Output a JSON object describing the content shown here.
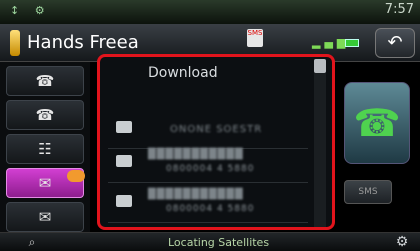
{
  "status_bar": {
    "time": "7:57",
    "icons": "↕ ⚙"
  },
  "header": {
    "title": "Hands Freea",
    "sms_label": "SMS",
    "back_symbol": "↶"
  },
  "sidebar": {
    "items": [
      {
        "icon": "☎"
      },
      {
        "icon": "☎"
      },
      {
        "icon": "☷"
      },
      {
        "icon": "✉"
      },
      {
        "icon": "✉"
      }
    ]
  },
  "list": {
    "header": "Download",
    "items": [
      {
        "name": "ONONE SOESTR",
        "number": ""
      },
      {
        "name": "███████████",
        "number": "0800004 4 5880"
      },
      {
        "name": "███████████",
        "number": "0800004 4 5880"
      }
    ]
  },
  "right_panel": {
    "call_symbol": "☎",
    "sms_label": "SMS"
  },
  "bottom_bar": {
    "status": "Locating Satellites",
    "search_symbol": "⌕",
    "settings_symbol": "⚙"
  },
  "colors": {
    "active_accent": "#d23fd2",
    "highlight_border": "#e2141c",
    "call_green": "#4fd24f"
  }
}
